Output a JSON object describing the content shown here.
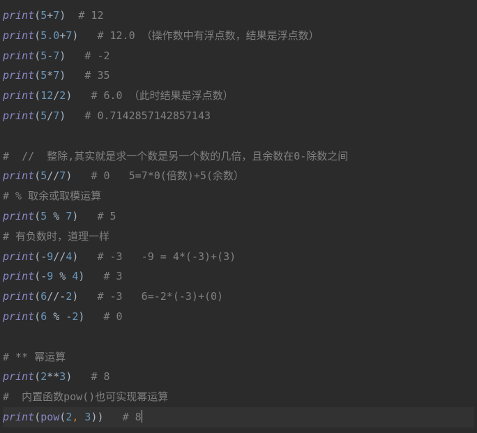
{
  "lines": [
    {
      "parts": [
        {
          "c": "fn",
          "t": "print"
        },
        {
          "c": "paren",
          "t": "("
        },
        {
          "c": "num",
          "t": "5"
        },
        {
          "c": "op",
          "t": "+"
        },
        {
          "c": "num",
          "t": "7"
        },
        {
          "c": "paren",
          "t": ")"
        },
        {
          "c": "op",
          "t": "  "
        },
        {
          "c": "comment",
          "t": "# 12"
        }
      ]
    },
    {
      "parts": [
        {
          "c": "fn",
          "t": "print"
        },
        {
          "c": "paren",
          "t": "("
        },
        {
          "c": "num",
          "t": "5.0"
        },
        {
          "c": "op",
          "t": "+"
        },
        {
          "c": "num",
          "t": "7"
        },
        {
          "c": "paren",
          "t": ")"
        },
        {
          "c": "op",
          "t": "   "
        },
        {
          "c": "comment",
          "t": "# 12.0 （操作数中有浮点数，结果是浮点数）"
        }
      ]
    },
    {
      "parts": [
        {
          "c": "fn",
          "t": "print"
        },
        {
          "c": "paren",
          "t": "("
        },
        {
          "c": "num",
          "t": "5"
        },
        {
          "c": "op",
          "t": "-"
        },
        {
          "c": "num",
          "t": "7"
        },
        {
          "c": "paren",
          "t": ")"
        },
        {
          "c": "op",
          "t": "   "
        },
        {
          "c": "comment",
          "t": "# -2"
        }
      ]
    },
    {
      "parts": [
        {
          "c": "fn",
          "t": "print"
        },
        {
          "c": "paren",
          "t": "("
        },
        {
          "c": "num",
          "t": "5"
        },
        {
          "c": "op",
          "t": "*"
        },
        {
          "c": "num",
          "t": "7"
        },
        {
          "c": "paren",
          "t": ")"
        },
        {
          "c": "op",
          "t": "   "
        },
        {
          "c": "comment",
          "t": "# 35"
        }
      ]
    },
    {
      "parts": [
        {
          "c": "fn",
          "t": "print"
        },
        {
          "c": "paren",
          "t": "("
        },
        {
          "c": "num",
          "t": "12"
        },
        {
          "c": "op",
          "t": "/"
        },
        {
          "c": "num",
          "t": "2"
        },
        {
          "c": "paren",
          "t": ")"
        },
        {
          "c": "op",
          "t": "   "
        },
        {
          "c": "comment",
          "t": "# 6.0 （此时结果是浮点数）"
        }
      ]
    },
    {
      "parts": [
        {
          "c": "fn",
          "t": "print"
        },
        {
          "c": "paren",
          "t": "("
        },
        {
          "c": "num",
          "t": "5"
        },
        {
          "c": "op",
          "t": "/"
        },
        {
          "c": "num",
          "t": "7"
        },
        {
          "c": "paren",
          "t": ")"
        },
        {
          "c": "op",
          "t": "   "
        },
        {
          "c": "comment",
          "t": "# 0.7142857142857143"
        }
      ]
    },
    {
      "parts": []
    },
    {
      "parts": [
        {
          "c": "comment",
          "t": "#  //  整除,其实就是求一个数是另一个数的几倍，且余数在0-除数之间"
        }
      ]
    },
    {
      "parts": [
        {
          "c": "fn",
          "t": "print"
        },
        {
          "c": "paren",
          "t": "("
        },
        {
          "c": "num",
          "t": "5"
        },
        {
          "c": "op",
          "t": "//"
        },
        {
          "c": "num",
          "t": "7"
        },
        {
          "c": "paren",
          "t": ")"
        },
        {
          "c": "op",
          "t": "   "
        },
        {
          "c": "comment",
          "t": "# 0   5=7*0(倍数)+5(余数）"
        }
      ]
    },
    {
      "parts": [
        {
          "c": "comment",
          "t": "# % 取余或取模运算"
        }
      ]
    },
    {
      "parts": [
        {
          "c": "fn",
          "t": "print"
        },
        {
          "c": "paren",
          "t": "("
        },
        {
          "c": "num",
          "t": "5"
        },
        {
          "c": "op",
          "t": " % "
        },
        {
          "c": "num",
          "t": "7"
        },
        {
          "c": "paren",
          "t": ")"
        },
        {
          "c": "op",
          "t": "   "
        },
        {
          "c": "comment",
          "t": "# 5"
        }
      ]
    },
    {
      "parts": [
        {
          "c": "comment",
          "t": "# 有负数时，道理一样"
        }
      ]
    },
    {
      "parts": [
        {
          "c": "fn",
          "t": "print"
        },
        {
          "c": "paren",
          "t": "("
        },
        {
          "c": "op",
          "t": "-"
        },
        {
          "c": "num",
          "t": "9"
        },
        {
          "c": "op",
          "t": "//"
        },
        {
          "c": "num",
          "t": "4"
        },
        {
          "c": "paren",
          "t": ")"
        },
        {
          "c": "op",
          "t": "   "
        },
        {
          "c": "comment",
          "t": "# -3   -9 = 4*(-3)+(3)"
        }
      ]
    },
    {
      "parts": [
        {
          "c": "fn",
          "t": "print"
        },
        {
          "c": "paren",
          "t": "("
        },
        {
          "c": "op",
          "t": "-"
        },
        {
          "c": "num",
          "t": "9"
        },
        {
          "c": "op",
          "t": " % "
        },
        {
          "c": "num",
          "t": "4"
        },
        {
          "c": "paren",
          "t": ")"
        },
        {
          "c": "op",
          "t": "   "
        },
        {
          "c": "comment",
          "t": "# 3"
        }
      ]
    },
    {
      "parts": [
        {
          "c": "fn",
          "t": "print"
        },
        {
          "c": "paren",
          "t": "("
        },
        {
          "c": "num",
          "t": "6"
        },
        {
          "c": "op",
          "t": "//-"
        },
        {
          "c": "num",
          "t": "2"
        },
        {
          "c": "paren",
          "t": ")"
        },
        {
          "c": "op",
          "t": "   "
        },
        {
          "c": "comment",
          "t": "# -3   6=-2*(-3)+(0)"
        }
      ]
    },
    {
      "parts": [
        {
          "c": "fn",
          "t": "print"
        },
        {
          "c": "paren",
          "t": "("
        },
        {
          "c": "num",
          "t": "6"
        },
        {
          "c": "op",
          "t": " % -"
        },
        {
          "c": "num",
          "t": "2"
        },
        {
          "c": "paren",
          "t": ")"
        },
        {
          "c": "op",
          "t": "   "
        },
        {
          "c": "comment",
          "t": "# 0"
        }
      ]
    },
    {
      "parts": []
    },
    {
      "parts": [
        {
          "c": "comment",
          "t": "# ** 幂运算"
        }
      ]
    },
    {
      "parts": [
        {
          "c": "fn",
          "t": "print"
        },
        {
          "c": "paren",
          "t": "("
        },
        {
          "c": "num",
          "t": "2"
        },
        {
          "c": "op",
          "t": "**"
        },
        {
          "c": "num",
          "t": "3"
        },
        {
          "c": "paren",
          "t": ")"
        },
        {
          "c": "op",
          "t": "   "
        },
        {
          "c": "comment",
          "t": "# 8"
        }
      ]
    },
    {
      "parts": [
        {
          "c": "comment",
          "t": "#  内置函数pow()也可实现幂运算"
        }
      ]
    },
    {
      "parts": [
        {
          "c": "fn",
          "t": "print"
        },
        {
          "c": "paren",
          "t": "("
        },
        {
          "c": "builtin",
          "t": "pow"
        },
        {
          "c": "paren",
          "t": "("
        },
        {
          "c": "num",
          "t": "2"
        },
        {
          "c": "comma",
          "t": ", "
        },
        {
          "c": "num",
          "t": "3"
        },
        {
          "c": "paren",
          "t": "))"
        },
        {
          "c": "op",
          "t": "   "
        },
        {
          "c": "comment",
          "t": "# 8"
        }
      ],
      "current": true,
      "cursor": true
    }
  ]
}
